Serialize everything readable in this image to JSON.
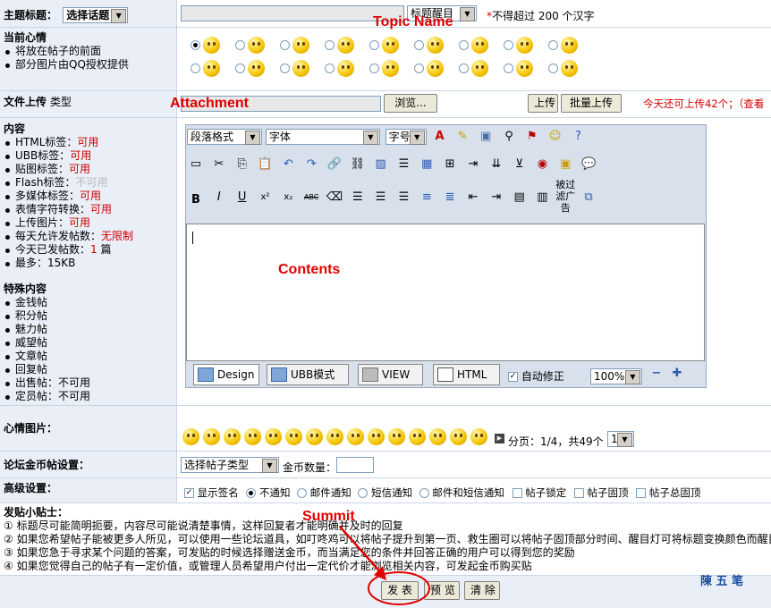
{
  "topic": {
    "label": "主题标题：",
    "topic_select": "选择话题",
    "title_select": "标题醒目",
    "required_mark": "*",
    "limit_note": "不得超过 200 个汉字"
  },
  "mood": {
    "label": "当前心情",
    "notes": [
      "将放在帖子的前面",
      "部分图片由QQ授权提供"
    ]
  },
  "upload": {
    "label": "文件上传",
    "sublabel": "类型",
    "browse_button": "浏览...",
    "upload_button": "上传",
    "batch_button": "批量上传",
    "quota_note": "今天还可上传42个；（查看"
  },
  "content": {
    "label": "内容",
    "rules": [
      {
        "name": "HTML标签：",
        "value": "可用",
        "state": "on"
      },
      {
        "name": "UBB标签：",
        "value": "可用",
        "state": "on"
      },
      {
        "name": "贴图标签：",
        "value": "可用",
        "state": "on"
      },
      {
        "name": "Flash标签：",
        "value": "不可用",
        "state": "off"
      },
      {
        "name": "多媒体标签：",
        "value": "可用",
        "state": "on"
      },
      {
        "name": "表情字符转换：",
        "value": "可用",
        "state": "on"
      },
      {
        "name": "上传图片：",
        "value": "可用",
        "state": "on"
      },
      {
        "name": "每天允许发帖数：",
        "value": "无限制",
        "state": "on"
      },
      {
        "name": "今天已发帖数：",
        "value": "1",
        "suffix": " 篇",
        "state": "on"
      },
      {
        "name": "最多：15KB",
        "value": "",
        "state": "plain"
      }
    ],
    "special_label": "特殊内容",
    "special_items": [
      "金钱帖",
      "积分帖",
      "魅力帖",
      "威望帖",
      "文章帖",
      "回复帖",
      "出售帖：不可用",
      "定员帖：不可用"
    ]
  },
  "editor": {
    "format_select": "段落格式",
    "font_select": "字体",
    "size_select": "字号",
    "ad_filter_label": "被过滤广告",
    "tabs": [
      "Design",
      "UBB模式",
      "VIEW",
      "HTML"
    ],
    "autocorrect_label": "自动修正",
    "zoom": "100%"
  },
  "mood_images": {
    "label": "心情图片：",
    "paging": "分页：1/4，共49个",
    "page_select": "1"
  },
  "gold": {
    "label": "论坛金币帖设置：",
    "type_select": "选择帖子类型",
    "amount_label": "金币数量："
  },
  "advanced": {
    "label": "高级设置：",
    "show_signature": "显示签名",
    "notify_options": [
      "不通知",
      "邮件通知",
      "短信通知",
      "邮件和短信通知"
    ],
    "lock_topic": "帖子锁定",
    "pin_topic": "帖子固顶",
    "pin_all": "帖子总固顶"
  },
  "tips": {
    "label": "发贴小贴士：",
    "lines": [
      "① 标题尽可能简明扼要，内容尽可能说清楚事情，这样回复者才能明确并及时的回复",
      "② 如果您希望帖子能被更多人所见，可以使用一些论坛道具，如叮咚鸡可以将帖子提升到第一页、救生圈可以将帖子固顶部分时间、醒目灯可将标题变换颜色而醒目",
      "③ 如果您急于寻求某个问题的答案，可发贴的时候选择赠送金币，而当满足您的条件并回答正确的用户可以得到您的奖励",
      "④ 如果您觉得自己的帖子有一定价值，或管理人员希望用户付出一定代价才能浏览相关内容，可发起金币购买贴"
    ]
  },
  "actions": {
    "submit": "发 表",
    "preview": "预 览",
    "clear": "清 除"
  },
  "annotations": {
    "topic_name": "Topic Name",
    "attachment": "Attachment",
    "contents": "Contents",
    "submit": "Summit"
  },
  "watermark": "陳 五 笔"
}
